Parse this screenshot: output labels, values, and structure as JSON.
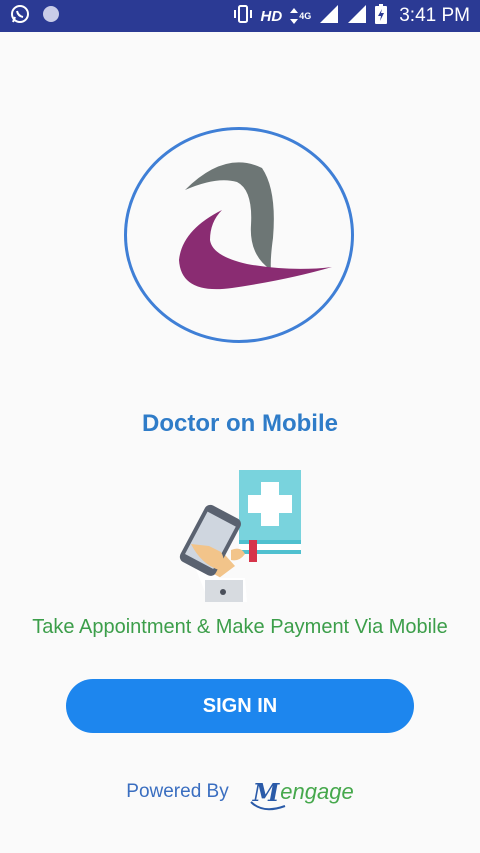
{
  "status_bar": {
    "network_type": "HD",
    "network_gen": "4G",
    "time": "3:41 PM",
    "background": "#2b3a94",
    "icons": [
      "whatsapp-icon",
      "notification-dot-icon",
      "vibrate-icon",
      "data-arrows-icon",
      "signal-icon",
      "signal-icon",
      "battery-charging-icon"
    ]
  },
  "logo": {
    "ring_color": "#3f7fd6",
    "grey_swoosh_color": "#6d7675",
    "purple_swoosh_color": "#8a2c72"
  },
  "app": {
    "title": "Doctor on Mobile",
    "tagline": "Take Appointment & Make Payment Via Mobile",
    "illustration_icon": "doctor-on-phone-icon"
  },
  "actions": {
    "signin_label": "SIGN IN",
    "signin_color": "#1d86ee"
  },
  "footer": {
    "powered_by": "Powered By",
    "brand_initial": "M",
    "brand_rest": "engage"
  }
}
